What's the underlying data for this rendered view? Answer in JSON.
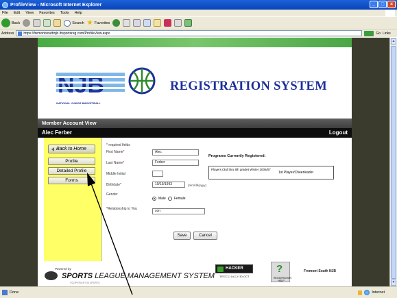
{
  "window": {
    "title": "ProfileView - Microsoft Internet Explorer",
    "buttons": [
      "_",
      "□",
      "×"
    ]
  },
  "menu": [
    "File",
    "Edit",
    "View",
    "Favorites",
    "Tools",
    "Help"
  ],
  "toolbar": {
    "back_label": "Back",
    "search_label": "Search",
    "favorites_label": "Favorites"
  },
  "address": {
    "label": "Address",
    "url": "https://fremontsouthnjb.ihsportsreg.com/ProfileView.aspx",
    "go_label": "Go",
    "links_label": "Links"
  },
  "header": {
    "title": "REGISTRATION SYSTEM",
    "logo_subtitle": "NATIONAL JUNIOR BASKETBALL",
    "logo_letters": "NJB"
  },
  "member_bar": {
    "title": "Member Account View"
  },
  "user_bar": {
    "name": "Alec Ferber",
    "logout_label": "Logout"
  },
  "sidebar": {
    "back_label": "Back to Home",
    "items": [
      "Profile",
      "Detailed Profile",
      "Forms"
    ]
  },
  "form": {
    "required_note": "required fields",
    "first_name_label": "First Name",
    "first_name_value": "Alec",
    "last_name_label": "Last Name",
    "last_name_value": "Ferber",
    "middle_initial_label": "Middle Initial",
    "middle_initial_value": "",
    "birthdate_label": "Birthdate",
    "birthdate_value": "10/19/1993",
    "birthdate_hint": "(mm/dd/yyyy)",
    "gender_label": "Gender",
    "gender_options": [
      "Male",
      "Female"
    ],
    "gender_selected": "Male",
    "relationship_label": "*Relationship to You",
    "relationship_value": "son",
    "save_label": "Save",
    "cancel_label": "Cancel"
  },
  "programs": {
    "title": "Programs Currently Registered:",
    "program_name": "Players (3rd thru 8th grade) Winter 2006/07",
    "program_role": "1st Player/Cheerleader"
  },
  "footer": {
    "powered_by": "Powered by",
    "sports_bold": "SPORTS",
    "sports_rest": " LEAGUE MANAGEMENT SYSTEM",
    "copyright": "©COPYRIGHT 04 SPORTS",
    "hacker_safe": "HACKER SAFE",
    "hacker_tested": "TESTED DAILY  30-OCT",
    "help_label": "REGISTRATION HELP",
    "league_name": "Fremont South NJB"
  },
  "status": {
    "left": "Done",
    "zone": "Internet"
  },
  "colors": {
    "sidebar_bg": "#ffff66",
    "title_blue": "#1c2f9a",
    "green_bar": "#4aa646"
  }
}
